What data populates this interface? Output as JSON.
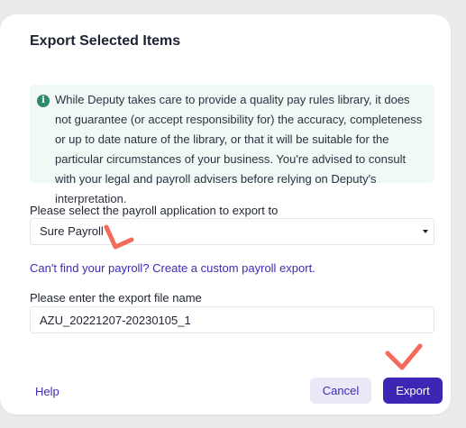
{
  "dialog": {
    "title": "Export Selected Items",
    "info_text": "While Deputy takes care to provide a quality pay rules library, it does not guarantee (or accept responsibility for) the accuracy, completeness or up to date nature of the library, or that it will be suitable for the particular circumstances of your business. You're advised to consult with your legal and payroll advisers before relying on Deputy's interpretation.",
    "info_icon": "info-circle-icon"
  },
  "payroll": {
    "label": "Please select the payroll application to export to",
    "selected": "Sure Payroll",
    "custom_link": "Can't find your payroll? Create a custom payroll export."
  },
  "file": {
    "label": "Please enter the export file name",
    "value": "AZU_20221207-20230105_1"
  },
  "footer": {
    "help": "Help",
    "cancel": "Cancel",
    "export": "Export"
  },
  "colors": {
    "accent": "#3c26b3",
    "info_bg": "#eff9f6",
    "annotation": "#f26b5b"
  }
}
